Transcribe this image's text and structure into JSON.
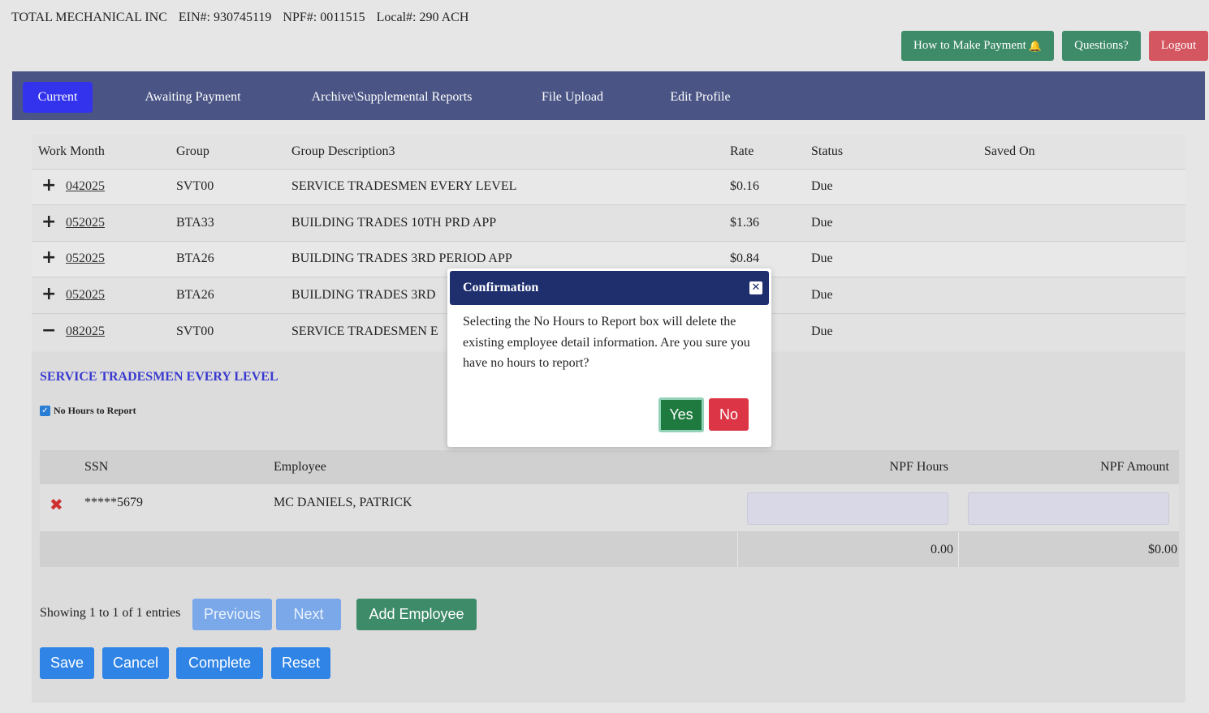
{
  "header": {
    "company": "TOTAL MECHANICAL INC",
    "ein": "EIN#: 930745119",
    "npf": "NPF#: 0011515",
    "local": "Local#: 290 ACH",
    "how_to_pay": "How to Make Payment",
    "questions": "Questions?",
    "logout": "Logout"
  },
  "nav": {
    "current": "Current",
    "awaiting": "Awaiting Payment",
    "archive": "Archive\\Supplemental Reports",
    "upload": "File Upload",
    "profile": "Edit Profile"
  },
  "grid": {
    "headers": {
      "work_month": "Work Month",
      "group": "Group",
      "description": "Group Description3",
      "rate": "Rate",
      "status": "Status",
      "saved_on": "Saved On"
    },
    "rows": [
      {
        "expander": "+",
        "month": "042025",
        "group": "SVT00",
        "description": "SERVICE TRADESMEN EVERY LEVEL",
        "rate": "$0.16",
        "status": "Due"
      },
      {
        "expander": "+",
        "month": "052025",
        "group": "BTA33",
        "description": "BUILDING TRADES 10TH PRD APP",
        "rate": "$1.36",
        "status": "Due"
      },
      {
        "expander": "+",
        "month": "052025",
        "group": "BTA26",
        "description": "BUILDING TRADES 3RD PERIOD APP",
        "rate": "$0.84",
        "status": "Due"
      },
      {
        "expander": "+",
        "month": "052025",
        "group": "BTA26",
        "description": "BUILDING TRADES 3RD",
        "rate": "",
        "status": "Due"
      },
      {
        "expander": "−",
        "month": "082025",
        "group": "SVT00",
        "description": "SERVICE TRADESMEN E",
        "rate": "",
        "status": "Due"
      }
    ]
  },
  "detail": {
    "title": "SERVICE TRADESMEN EVERY LEVEL",
    "no_hours_label": "No Hours to Report",
    "no_hours_checked": true,
    "table": {
      "headers": {
        "ssn": "SSN",
        "employee": "Employee",
        "hours": "NPF Hours",
        "amount": "NPF Amount"
      },
      "rows": [
        {
          "ssn": "*****5679",
          "employee": "MC DANIELS, PATRICK",
          "hours": "",
          "amount": ""
        }
      ],
      "totals": {
        "hours": "0.00",
        "amount": "$0.00"
      }
    },
    "showing": "Showing 1 to 1 of 1 entries",
    "previous": "Previous",
    "next": "Next",
    "add_employee": "Add Employee",
    "save": "Save",
    "cancel": "Cancel",
    "complete": "Complete",
    "reset": "Reset"
  },
  "modal": {
    "title": "Confirmation",
    "body": "Selecting the No Hours to Report box will delete the existing employee detail information. Are you sure you have no hours to report?",
    "yes": "Yes",
    "no": "No"
  },
  "colors": {
    "nav_bg": "#4a5585",
    "nav_active": "#3333ee",
    "green": "#3e8b69",
    "red": "#d45661",
    "blue_button": "#2f84e6",
    "modal_header": "#1f2f6e"
  }
}
